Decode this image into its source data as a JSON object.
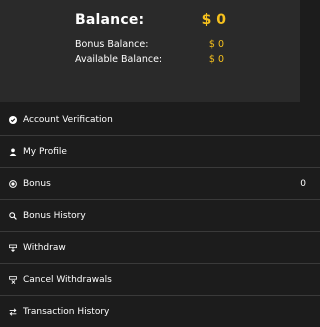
{
  "header": {
    "balance_label": "Balance:",
    "balance_value": "$ 0",
    "bonus_balance_label": "Bonus Balance:",
    "bonus_balance_value": "$ 0",
    "available_balance_label": "Available Balance:",
    "available_balance_value": "$ 0"
  },
  "menu": {
    "items": [
      {
        "label": "Account Verification",
        "icon": "check-circle-icon"
      },
      {
        "label": "My Profile",
        "icon": "user-icon"
      },
      {
        "label": "Bonus",
        "icon": "bonus-circle-icon",
        "count": "0"
      },
      {
        "label": "Bonus History",
        "icon": "search-history-icon"
      },
      {
        "label": "Withdraw",
        "icon": "withdraw-icon"
      },
      {
        "label": "Cancel Withdrawals",
        "icon": "cancel-withdraw-icon"
      },
      {
        "label": "Transaction History",
        "icon": "transaction-history-icon"
      }
    ]
  },
  "colors": {
    "accent": "#f6c11d",
    "background": "#1c1c1c",
    "header_background": "#2a2a2a",
    "divider": "#3a3a3a"
  }
}
